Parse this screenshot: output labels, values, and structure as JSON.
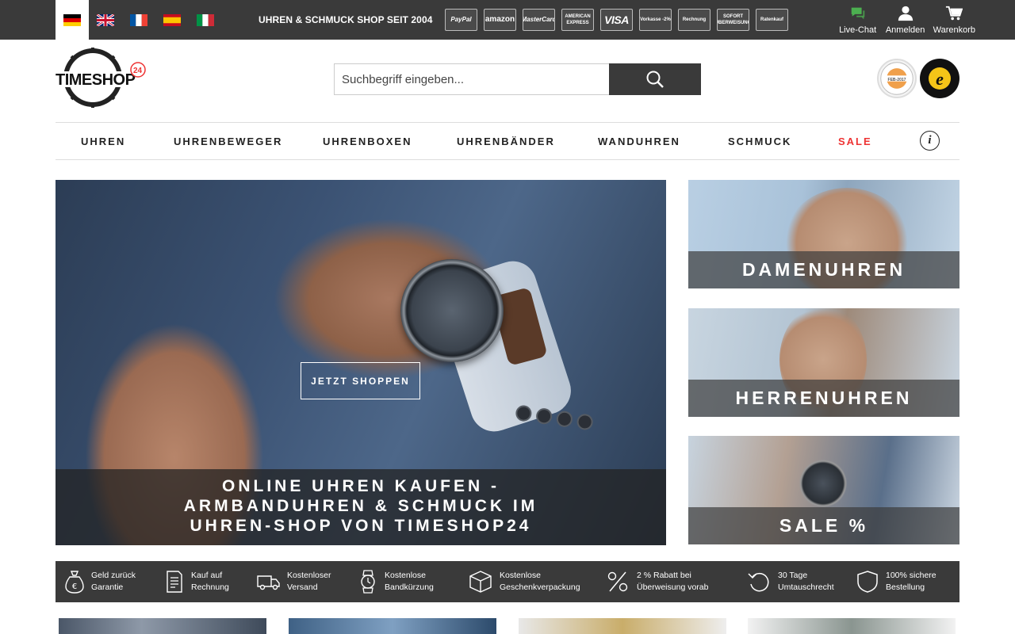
{
  "topbar": {
    "languages": [
      {
        "code": "de",
        "icon": "flag-germany-icon",
        "active": true
      },
      {
        "code": "en",
        "icon": "flag-uk-icon",
        "active": false
      },
      {
        "code": "fr",
        "icon": "flag-france-icon",
        "active": false
      },
      {
        "code": "es",
        "icon": "flag-spain-icon",
        "active": false
      },
      {
        "code": "it",
        "icon": "flag-italy-icon",
        "active": false
      }
    ],
    "slogan": "UHREN & SCHMUCK SHOP SEIT 2004",
    "payment_methods": [
      {
        "label": "PayPal"
      },
      {
        "label": "amazon"
      },
      {
        "label": "MasterCard"
      },
      {
        "label": "AMERICAN EXPRESS"
      },
      {
        "label": "VISA"
      },
      {
        "label": "Vorkasse -2%"
      },
      {
        "label": "Rechnung"
      },
      {
        "label": "SOFORT ÜBERWEISUNG"
      },
      {
        "label": "Ratenkauf"
      }
    ],
    "actions": {
      "chat_label": "Live-Chat",
      "login_label": "Anmelden",
      "cart_label": "Warenkorb"
    }
  },
  "header": {
    "logo_text": "TIMESHOP",
    "logo_badge": "24",
    "search_placeholder": "Suchbegriff eingeben...",
    "seal1_text": "FEB-2017",
    "seal2_text": "e"
  },
  "nav": {
    "items": [
      {
        "label": "UHREN"
      },
      {
        "label": "UHRENBEWEGER"
      },
      {
        "label": "UHRENBOXEN"
      },
      {
        "label": "UHRENBÄNDER"
      },
      {
        "label": "WANDUHREN"
      },
      {
        "label": "SCHMUCK"
      },
      {
        "label": "SALE"
      }
    ],
    "info_label": "i",
    "sale_color": "#e33333"
  },
  "hero": {
    "cta_label": "JETZT SHOPPEN",
    "caption_line1": "ONLINE UHREN KAUFEN -",
    "caption_line2": "ARMBANDUHREN & SCHMUCK IM",
    "caption_line3": "UHREN-SHOP VON TIMESHOP24"
  },
  "tiles": [
    {
      "label": "DAMENUHREN"
    },
    {
      "label": "HERRENUHREN"
    },
    {
      "label": "SALE %"
    }
  ],
  "usp": [
    {
      "line1": "Geld zurück",
      "line2": "Garantie",
      "icon": "money-bag-icon"
    },
    {
      "line1": "Kauf auf",
      "line2": "Rechnung",
      "icon": "invoice-icon"
    },
    {
      "line1": "Kostenloser",
      "line2": "Versand",
      "icon": "truck-icon"
    },
    {
      "line1": "Kostenlose",
      "line2": "Bandkürzung",
      "icon": "watch-icon"
    },
    {
      "line1": "Kostenlose",
      "line2": "Geschenkverpackung",
      "icon": "box-icon"
    },
    {
      "line1": "2 % Rabatt bei",
      "line2": "Überweisung vorab",
      "icon": "percent-icon"
    },
    {
      "line1": "30 Tage",
      "line2": "Umtauschrecht",
      "icon": "return-icon"
    },
    {
      "line1": "100% sichere",
      "line2": "Bestellung",
      "icon": "shield-icon"
    }
  ],
  "colors": {
    "topbar_bg": "#3a3a3a",
    "sale_red": "#e33333",
    "chat_green": "#4caf50"
  }
}
